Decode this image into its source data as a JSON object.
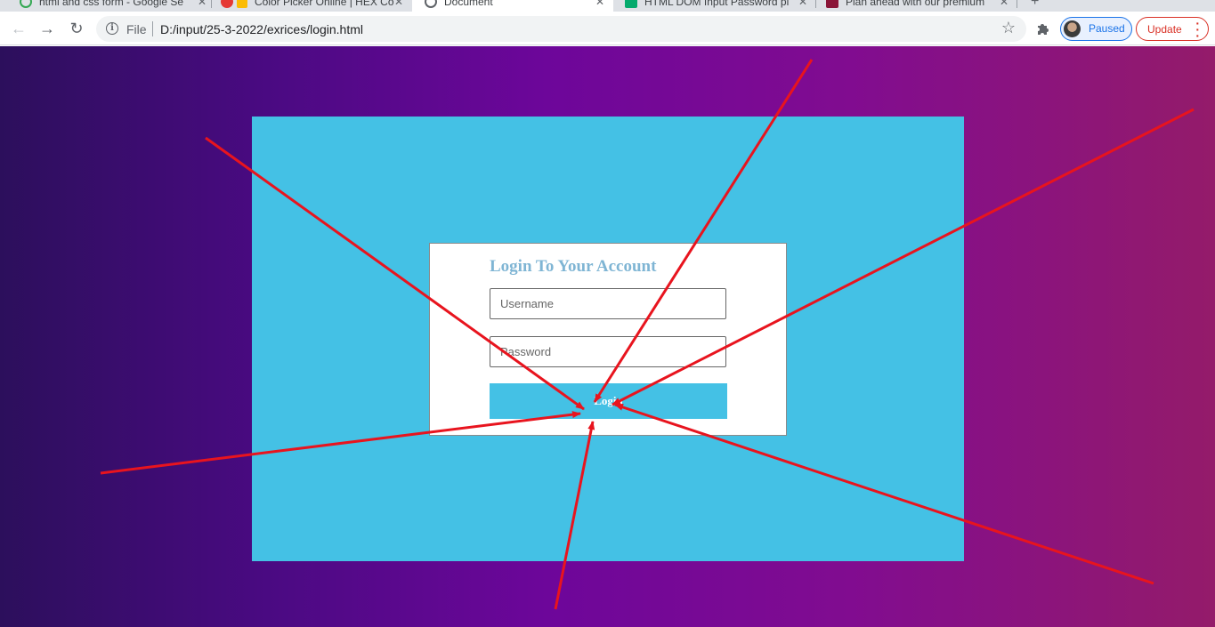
{
  "browser": {
    "tabs": [
      {
        "title": "html and css form - Google Se"
      },
      {
        "title": "Color Picker Online | HEX Co"
      },
      {
        "title": "Document"
      },
      {
        "title": "HTML DOM Input Password pl"
      },
      {
        "title": "Plan ahead with our premium"
      }
    ],
    "address_bar": {
      "scheme_label": "File",
      "url": "D:/input/25-3-2022/exrices/login.html"
    },
    "profile_status": "Paused",
    "update_label": "Update"
  },
  "login_form": {
    "title": "Login To Your Account",
    "username_placeholder": "Username",
    "password_placeholder": "Password",
    "submit_label": "Login"
  },
  "colors": {
    "inner_box": "#44c1e5",
    "title": "#7fb5d4",
    "arrows": "#e8141e"
  }
}
